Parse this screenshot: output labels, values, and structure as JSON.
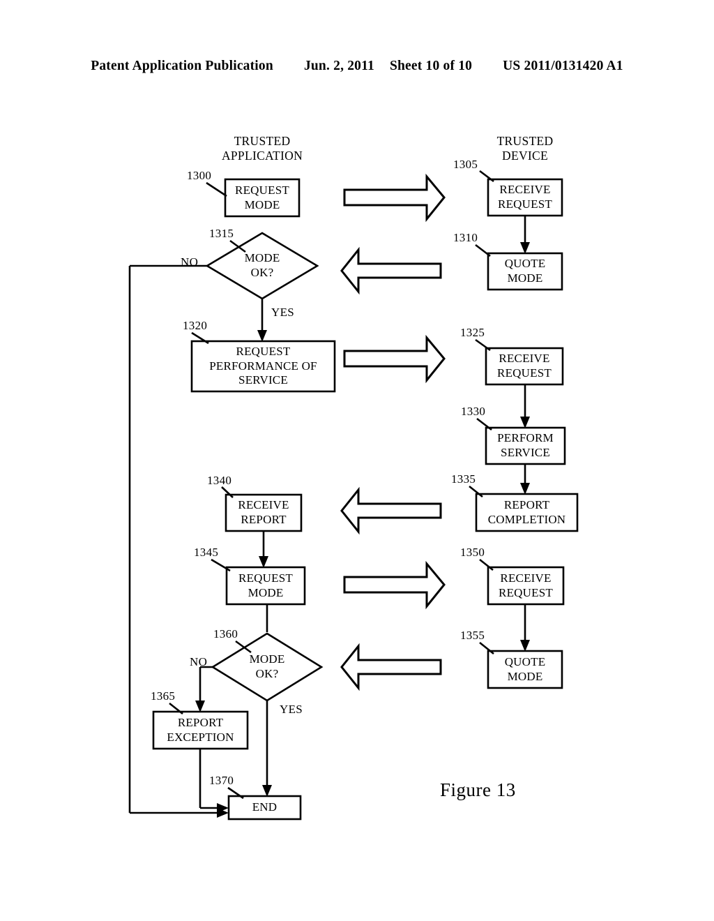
{
  "header": {
    "publication": "Patent Application Publication",
    "date": "Jun. 2, 2011",
    "sheet": "Sheet 10 of 10",
    "doc_number": "US 2011/0131420 A1"
  },
  "figure": {
    "caption": "Figure 13",
    "columns": [
      {
        "id": "left-column",
        "line1": "TRUSTED",
        "line2": "APPLICATION"
      },
      {
        "id": "right-column",
        "line1": "TRUSTED",
        "line2": "DEVICE"
      }
    ],
    "nodes": [
      {
        "id": "request-mode-1300",
        "ref": "1300",
        "shape": "process",
        "line1": "REQUEST",
        "line2": "MODE",
        "line3": ""
      },
      {
        "id": "receive-request-1305",
        "ref": "1305",
        "shape": "process",
        "line1": "RECEIVE",
        "line2": "REQUEST",
        "line3": ""
      },
      {
        "id": "quote-mode-1310",
        "ref": "1310",
        "shape": "process",
        "line1": "QUOTE",
        "line2": "MODE",
        "line3": ""
      },
      {
        "id": "mode-ok-1315",
        "ref": "1315",
        "shape": "decision",
        "line1": "MODE",
        "line2": "OK?",
        "line3": ""
      },
      {
        "id": "request-performance-1320",
        "ref": "1320",
        "shape": "process",
        "line1": "REQUEST",
        "line2": "PERFORMANCE OF",
        "line3": "SERVICE"
      },
      {
        "id": "receive-request-1325",
        "ref": "1325",
        "shape": "process",
        "line1": "RECEIVE",
        "line2": "REQUEST",
        "line3": ""
      },
      {
        "id": "perform-service-1330",
        "ref": "1330",
        "shape": "process",
        "line1": "PERFORM",
        "line2": "SERVICE",
        "line3": ""
      },
      {
        "id": "report-completion-1335",
        "ref": "1335",
        "shape": "process",
        "line1": "REPORT",
        "line2": "COMPLETION",
        "line3": ""
      },
      {
        "id": "receive-report-1340",
        "ref": "1340",
        "shape": "process",
        "line1": "RECEIVE",
        "line2": "REPORT",
        "line3": ""
      },
      {
        "id": "request-mode-1345",
        "ref": "1345",
        "shape": "process",
        "line1": "REQUEST",
        "line2": "MODE",
        "line3": ""
      },
      {
        "id": "receive-request-1350",
        "ref": "1350",
        "shape": "process",
        "line1": "RECEIVE",
        "line2": "REQUEST",
        "line3": ""
      },
      {
        "id": "quote-mode-1355",
        "ref": "1355",
        "shape": "process",
        "line1": "QUOTE",
        "line2": "MODE",
        "line3": ""
      },
      {
        "id": "mode-ok-1360",
        "ref": "1360",
        "shape": "decision",
        "line1": "MODE",
        "line2": "OK?",
        "line3": ""
      },
      {
        "id": "report-exception-1365",
        "ref": "1365",
        "shape": "process",
        "line1": "REPORT",
        "line2": "EXCEPTION",
        "line3": ""
      },
      {
        "id": "end-1370",
        "ref": "1370",
        "shape": "terminal",
        "line1": "END",
        "line2": "",
        "line3": ""
      }
    ],
    "branch_labels": {
      "no_upper": "NO",
      "yes_upper": "YES",
      "no_lower": "NO",
      "yes_lower": "YES"
    },
    "block_arrows": [
      {
        "id": "block-arrow-request-mode",
        "direction": "right"
      },
      {
        "id": "block-arrow-quote-mode",
        "direction": "left"
      },
      {
        "id": "block-arrow-request-performance",
        "direction": "right"
      },
      {
        "id": "block-arrow-report-completion",
        "direction": "left"
      },
      {
        "id": "block-arrow-request-mode-2",
        "direction": "right"
      },
      {
        "id": "block-arrow-quote-mode-2",
        "direction": "left"
      }
    ],
    "colors": {
      "ink": "#000000",
      "paper": "#ffffff"
    }
  }
}
